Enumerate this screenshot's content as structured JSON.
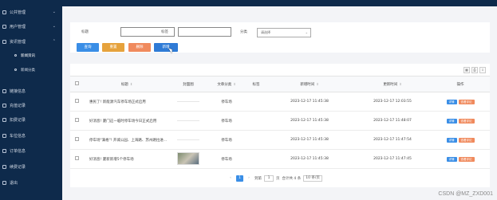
{
  "sidebar": {
    "items": [
      {
        "label": "公共管理",
        "icon": "grid-icon"
      },
      {
        "label": "用户管理",
        "icon": "user-icon"
      },
      {
        "label": "资讯管理",
        "icon": "news-icon"
      },
      {
        "label": "链接信息",
        "icon": "link-icon"
      },
      {
        "label": "充值记录",
        "icon": "wallet-icon"
      },
      {
        "label": "扣费记录",
        "icon": "receipt-icon"
      },
      {
        "label": "车位信息",
        "icon": "parking-icon"
      },
      {
        "label": "订单信息",
        "icon": "order-icon"
      },
      {
        "label": "续费记录",
        "icon": "renew-icon"
      },
      {
        "label": "退出",
        "icon": "logout-icon"
      }
    ],
    "subitems": [
      {
        "label": "新闻资讯"
      },
      {
        "label": "新闻分类"
      }
    ]
  },
  "filters": {
    "title_label": "标题",
    "tag_label": "标签",
    "category_label": "分类",
    "category_placeholder": "请选择"
  },
  "buttons": {
    "search": "查询",
    "reset": "重置",
    "delete": "删除",
    "add": "新增"
  },
  "table": {
    "headers": [
      "标题",
      "封面图",
      "文章分类",
      "标签",
      "新增时间",
      "更新时间",
      "操作"
    ],
    "rows": [
      {
        "title": "惠民了! 新能源汽车停车场正式启用",
        "category": "停车场",
        "tag": "",
        "created": "2023-12-17 11:45:38",
        "updated": "2023-12-17 12:03:55",
        "thumb": false
      },
      {
        "title": "好消息! 厦门这一临时停车场今日正式启用",
        "category": "停车场",
        "tag": "",
        "created": "2023-12-17 11:45:38",
        "updated": "2023-12-17 11:48:07",
        "thumb": false
      },
      {
        "title": "停车场\"满格\"! 开城公园、上海路、苏州路拉进...",
        "category": "停车场",
        "tag": "",
        "created": "2023-12-17 11:45:38",
        "updated": "2023-12-17 11:47:54",
        "thumb": true
      },
      {
        "title": "好消息! 厦新新增5个停车场",
        "category": "停车场",
        "tag": "",
        "created": "2023-12-17 11:45:38",
        "updated": "2023-12-17 11:47:45",
        "thumb": true
      }
    ],
    "actions": {
      "detail": "详情",
      "edit": "查看评论"
    }
  },
  "pager": {
    "prev": "‹",
    "current": "1",
    "next": "›",
    "goto_label": "到第",
    "goto_value": "1",
    "page_unit": "页",
    "total": "合计共 4 条",
    "per_page": "10 条/页"
  },
  "watermark": "CSDN @MZ_ZXD001",
  "colors": {
    "sidebar_bg": "#0e2a4b",
    "search_btn": "#3a8ee6",
    "reset_btn": "#e6a23c",
    "delete_btn": "#f08a5d",
    "add_btn": "#2f7bd6"
  }
}
